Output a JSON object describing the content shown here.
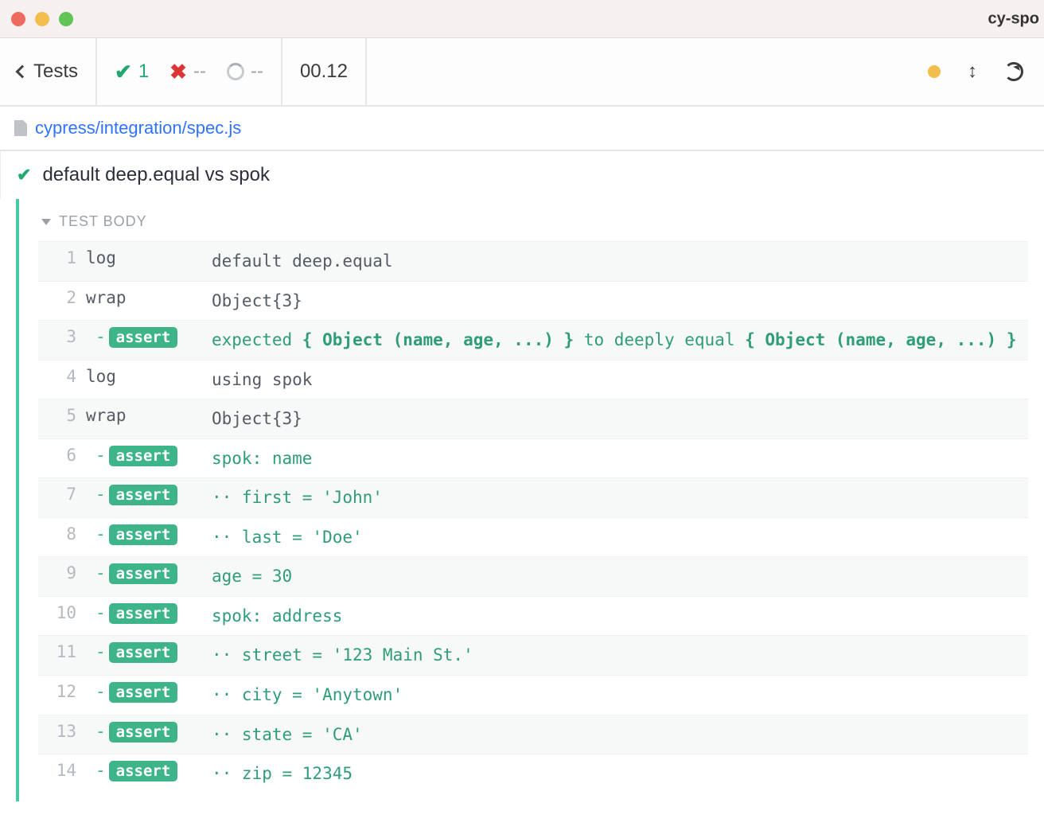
{
  "window": {
    "title": "cy-spo"
  },
  "toolbar": {
    "back_label": "Tests",
    "pass_count": "1",
    "fail_count": "--",
    "pending_count": "--",
    "duration": "00.12"
  },
  "spec": {
    "path": "cypress/integration/spec.js"
  },
  "test": {
    "title": "default deep.equal vs spok",
    "section": "TEST BODY"
  },
  "commands": [
    {
      "num": "1",
      "type": "plain",
      "name": "log",
      "msg": "default deep.equal",
      "shade": true
    },
    {
      "num": "2",
      "type": "plain",
      "name": "wrap",
      "msg": "Object{3}",
      "shade": false
    },
    {
      "num": "3",
      "type": "assert",
      "segments": [
        {
          "t": "expected ",
          "b": false
        },
        {
          "t": "{ Object (name, age, ...) }",
          "b": true
        },
        {
          "t": " to deeply equal ",
          "b": false
        },
        {
          "t": "{ Object (name, age, ...) }",
          "b": true
        }
      ],
      "shade": true
    },
    {
      "num": "4",
      "type": "plain",
      "name": "log",
      "msg": "using spok",
      "shade": false
    },
    {
      "num": "5",
      "type": "plain",
      "name": "wrap",
      "msg": "Object{3}",
      "shade": true
    },
    {
      "num": "6",
      "type": "assert_simple",
      "msg": "spok: name",
      "shade": false
    },
    {
      "num": "7",
      "type": "assert_simple",
      "msg": "·· first = 'John'",
      "shade": true
    },
    {
      "num": "8",
      "type": "assert_simple",
      "msg": "·· last = 'Doe'",
      "shade": false
    },
    {
      "num": "9",
      "type": "assert_simple",
      "msg": "age = 30",
      "shade": true
    },
    {
      "num": "10",
      "type": "assert_simple",
      "msg": "spok: address",
      "shade": false
    },
    {
      "num": "11",
      "type": "assert_simple",
      "msg": "·· street = '123 Main St.'",
      "shade": true
    },
    {
      "num": "12",
      "type": "assert_simple",
      "msg": "·· city = 'Anytown'",
      "shade": false
    },
    {
      "num": "13",
      "type": "assert_simple",
      "msg": "·· state = 'CA'",
      "shade": true
    },
    {
      "num": "14",
      "type": "assert_simple",
      "msg": "·· zip = 12345",
      "shade": false
    }
  ],
  "labels": {
    "assert": "assert"
  }
}
